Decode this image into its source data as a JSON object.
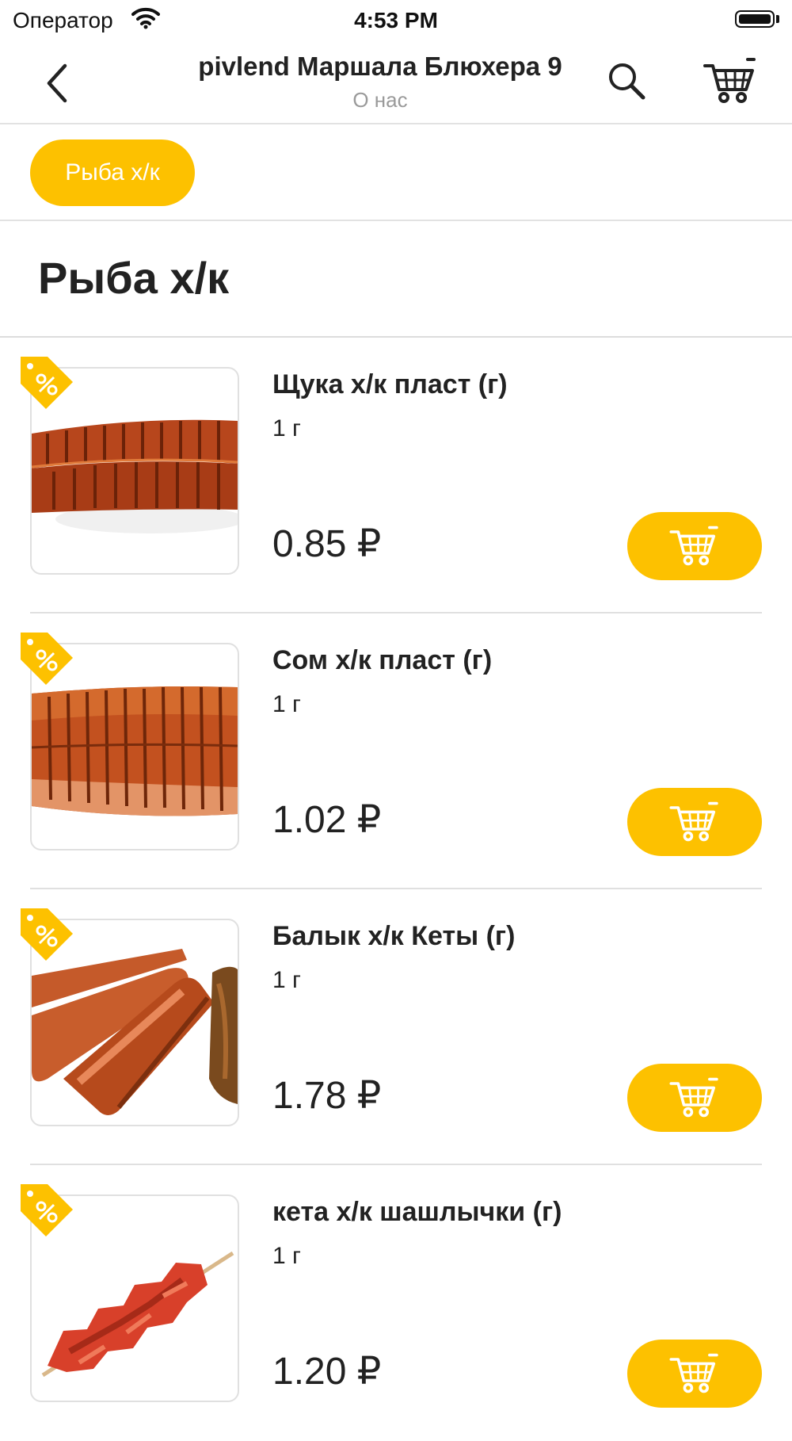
{
  "status_bar": {
    "carrier": "Оператор",
    "time": "4:53 PM"
  },
  "nav": {
    "title": "pivlend Маршала Блюхера 9",
    "subtitle": "О нас"
  },
  "categories": [
    {
      "label": "Рыба х/к",
      "active": true
    }
  ],
  "section": {
    "title": "Рыба х/к"
  },
  "accent_color": "#fdc100",
  "products": [
    {
      "name": "Щука х/к пласт (г)",
      "weight": "1 г",
      "price": "0.85 ₽"
    },
    {
      "name": "Сом х/к пласт (г)",
      "weight": "1 г",
      "price": "1.02 ₽"
    },
    {
      "name": "Балык х/к Кеты (г)",
      "weight": "1 г",
      "price": "1.78 ₽"
    },
    {
      "name": "кета х/к шашлычки (г)",
      "weight": "1 г",
      "price": "1.20 ₽"
    }
  ]
}
